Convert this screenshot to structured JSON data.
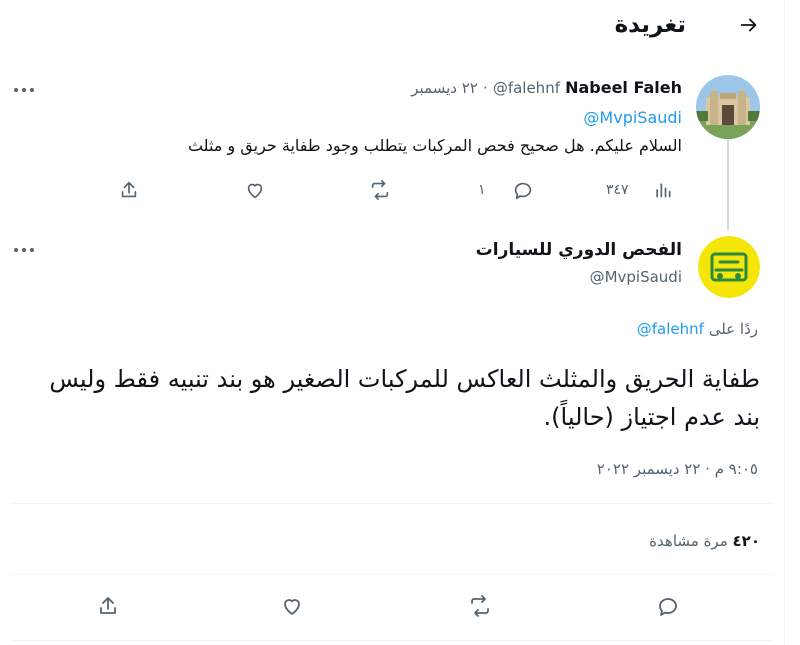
{
  "header": {
    "title": "تغريدة",
    "back_icon": "arrow-back-icon"
  },
  "parent_tweet": {
    "author_name": "Nabeel Faleh",
    "handle": "@falehnf",
    "separator": "·",
    "date": "٢٢ ديسمبر",
    "mention": "@MvpiSaudi",
    "text": "السلام عليكم. هل صحيح فحص المركبات يتطلب وجود طفاية حريق و مثلث",
    "stats": {
      "views": "٣٤٧",
      "replies": "١"
    }
  },
  "main_tweet": {
    "author_name": "الفحص الدوري للسيارات",
    "handle": "@MvpiSaudi",
    "replying_prefix": "ردًا على",
    "replying_to": "@falehnf",
    "text": "طفاية الحريق والمثلث العاكس للمركبات الصغير هو بند تنبيه فقط وليس بند عدم اجتياز (حالياً).",
    "time": "٩:٠٥ م · ٢٢ ديسمبر ٢٠٢٢",
    "views_count": "٤٢٠",
    "views_label": "مرة مشاهدة"
  },
  "colors": {
    "text": "#0f1419",
    "secondary": "#536471",
    "accent": "#1d9bf0",
    "border": "#eff3f4",
    "thread_line": "#cfd9de",
    "avatar2_bg": "#f5e60a",
    "avatar2_green": "#2b8a3e"
  }
}
